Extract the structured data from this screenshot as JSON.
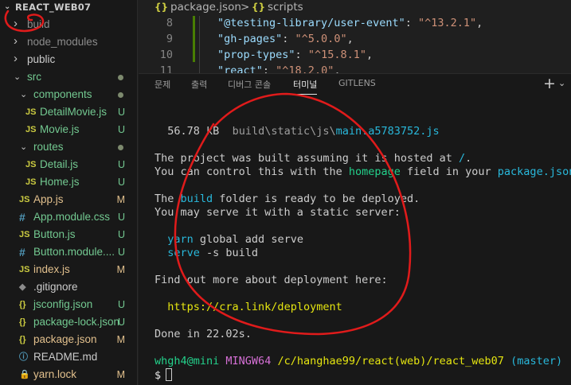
{
  "explorer": {
    "header": "REACT_WEB07",
    "items": [
      {
        "label": "build",
        "type": "folder",
        "open": false,
        "status": ""
      },
      {
        "label": "node_modules",
        "type": "folder",
        "open": false,
        "status": ""
      },
      {
        "label": "public",
        "type": "folder",
        "open": false,
        "status": ""
      },
      {
        "label": "src",
        "type": "folder",
        "open": true,
        "status": "dot"
      },
      {
        "label": "components",
        "type": "folder",
        "open": true,
        "status": "dot"
      },
      {
        "label": "DetailMovie.js",
        "type": "js",
        "status": "U"
      },
      {
        "label": "Movie.js",
        "type": "js",
        "status": "U"
      },
      {
        "label": "routes",
        "type": "folder",
        "open": true,
        "status": "dot"
      },
      {
        "label": "Detail.js",
        "type": "js",
        "status": "U"
      },
      {
        "label": "Home.js",
        "type": "js",
        "status": "U"
      },
      {
        "label": "App.js",
        "type": "js",
        "status": "M"
      },
      {
        "label": "App.module.css",
        "type": "css",
        "status": "U"
      },
      {
        "label": "Button.js",
        "type": "js",
        "status": "U"
      },
      {
        "label": "Button.module....",
        "type": "css",
        "status": "U"
      },
      {
        "label": "index.js",
        "type": "js",
        "status": "M"
      },
      {
        "label": ".gitignore",
        "type": "git",
        "status": ""
      },
      {
        "label": "jsconfig.json",
        "type": "json",
        "status": "U"
      },
      {
        "label": "package-lock.json",
        "type": "json",
        "status": "U"
      },
      {
        "label": "package.json",
        "type": "json",
        "status": "M"
      },
      {
        "label": "README.md",
        "type": "md",
        "status": ""
      },
      {
        "label": "yarn.lock",
        "type": "lock",
        "status": "M"
      }
    ],
    "icons": {
      "js": "JS",
      "css": "#",
      "json": "{}",
      "md": "ⓘ",
      "git": "◆",
      "lock": "🔒"
    }
  },
  "breadcrumb": {
    "file_icon": "{}",
    "file": "package.json",
    "sep": ">",
    "section_icon": "{}",
    "section": "scripts"
  },
  "editor": {
    "lines": [
      {
        "num": "8",
        "key": "\"@testing-library/user-event\"",
        "value": "\"^13.2.1\""
      },
      {
        "num": "9",
        "key": "\"gh-pages\"",
        "value": "\"^5.0.0\""
      },
      {
        "num": "10",
        "key": "\"prop-types\"",
        "value": "\"^15.8.1\""
      },
      {
        "num": "11",
        "key": "\"react\"",
        "value": "\"^18.2.0\""
      }
    ]
  },
  "panel": {
    "tabs": [
      "문제",
      "출력",
      "디버그 콘솔",
      "터미널",
      "GITLENS"
    ],
    "active_tab": "터미널",
    "plus": "+",
    "chevron": "⌄"
  },
  "terminal": {
    "size": "56.78 kB",
    "path_dir": "build\\static\\js\\",
    "path_file": "main.a5783752.js",
    "built_pre": "The project was built assuming it is hosted at ",
    "built_slash": "/",
    "built_post": ".",
    "control_pre": "You can control this with the ",
    "control_homepage": "homepage",
    "control_mid": " field in your ",
    "control_pkg": "package.json",
    "control_post": ".",
    "ready_pre": "The ",
    "ready_build": "build",
    "ready_post": " folder is ready to be deployed.",
    "serve_line": "You may serve it with a static server:",
    "cmd1_tool": "yarn",
    "cmd1_rest": " global add serve",
    "cmd2_tool": "serve",
    "cmd2_rest": " -s build",
    "findout": "Find out more about deployment here:",
    "link": "https://cra.link/deployment",
    "done": "Done in 22.02s.",
    "prompt_user": "whgh4@mini",
    "prompt_shell": "MINGW64",
    "prompt_path": "/c/hanghae99/react(web)/react_web07",
    "prompt_branch": "(master)",
    "prompt_symbol": "$"
  },
  "colors": {
    "annotation": "#e01b1b",
    "untracked": "#73c991",
    "modified": "#e2c08d"
  }
}
